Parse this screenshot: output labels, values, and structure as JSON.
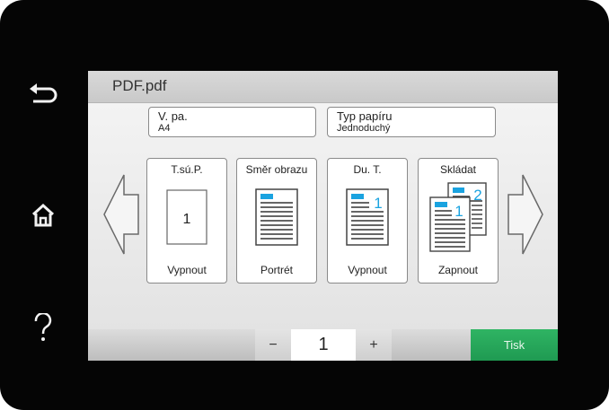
{
  "title": "PDF.pdf",
  "fields": {
    "paper_size": {
      "label": "V. pa.",
      "value": "A4"
    },
    "paper_type": {
      "label": "Typ papíru",
      "value": "Jednoduchý"
    }
  },
  "cards": [
    {
      "title": "T.sú.P.",
      "value": "Vypnout",
      "icon_number": "1",
      "icon": "page-icon"
    },
    {
      "title": "Směr obrazu",
      "value": "Portrét",
      "icon": "portrait-document-icon"
    },
    {
      "title": "Du. T.",
      "value": "Vypnout",
      "icon_number": "1",
      "icon": "single-sided-document-icon"
    },
    {
      "title": "Skládat",
      "value": "Zapnout",
      "icon_numbers": [
        "2",
        "1"
      ],
      "icon": "collate-documents-icon"
    }
  ],
  "copies": {
    "value": "1",
    "minus": "−",
    "plus": "+"
  },
  "print_label": "Tisk",
  "side_buttons": [
    "back-icon",
    "home-icon",
    "help-icon"
  ],
  "colors": {
    "accent_green": "#27a85a",
    "doc_blue": "#1aa3e0"
  }
}
